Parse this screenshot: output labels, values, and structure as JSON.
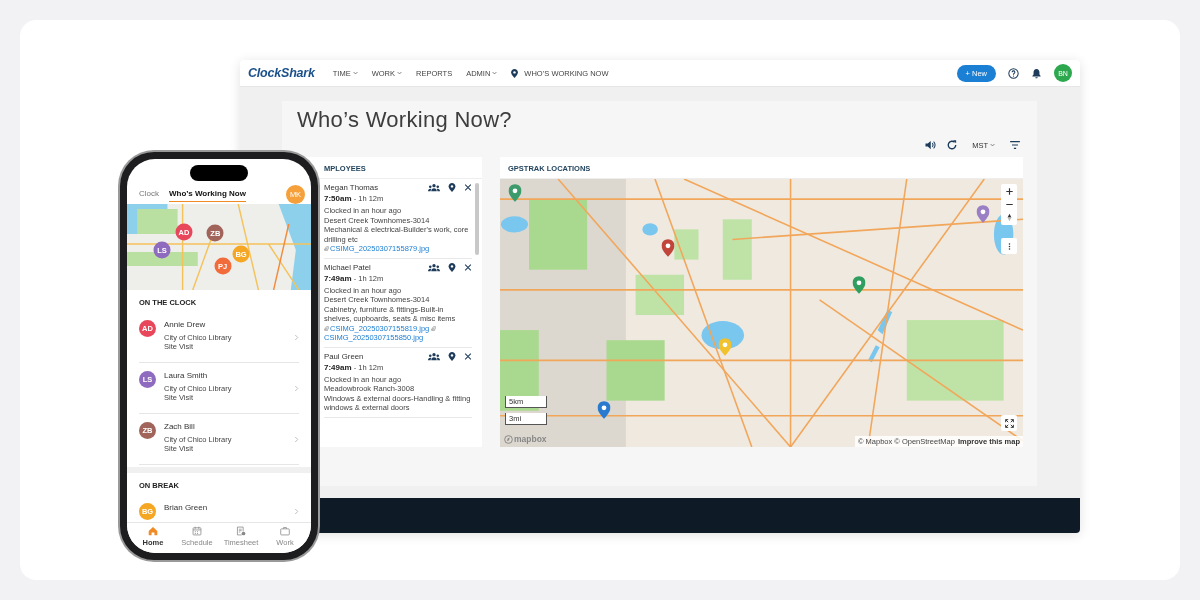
{
  "nav": {
    "logo": "ClockShark",
    "menu": [
      {
        "label": "TIME",
        "kind": "dropdown"
      },
      {
        "label": "WORK",
        "kind": "dropdown"
      },
      {
        "label": "REPORTS",
        "kind": "link"
      },
      {
        "label": "ADMIN",
        "kind": "dropdown"
      },
      {
        "label": "WHO’S WORKING NOW",
        "kind": "location"
      }
    ],
    "new_button": "+ New",
    "user_initials": "BN"
  },
  "page": {
    "title": "Who’s Working Now?",
    "timezone": "MST"
  },
  "employees": {
    "header": "MPLOYEES",
    "items": [
      {
        "name": "Megan Thomas",
        "time": "7:50am",
        "duration": "- 1h 12m",
        "details": [
          "Clocked in an hour ago",
          "Desert Creek Townhomes-3014",
          "Mechanical & electrical-Builder's work, core drilling etc"
        ],
        "attachments": [
          "CSIMG_20250307155879.jpg"
        ]
      },
      {
        "name": "Michael Patel",
        "time": "7:49am",
        "duration": "- 1h 12m",
        "details": [
          "Clocked in an hour ago",
          "Desert Creek Townhomes-3014",
          "Cabinetry, furniture & fittings-Built-in shelves, cupboards, seats & misc items"
        ],
        "attachments": [
          "CSIMG_20250307155819.jpg",
          "CSIMG_20250307155850.jpg"
        ]
      },
      {
        "name": "Paul Green",
        "time": "7:49am",
        "duration": "- 1h 12m",
        "details": [
          "Clocked in an hour ago",
          "Meadowbrook Ranch-3008",
          "Windows & external doors-Handling & fitting windows & external doors"
        ]
      }
    ]
  },
  "map": {
    "header": "GPSTRAK LOCATIONS",
    "pins": [
      {
        "color": "#3d9a6a"
      },
      {
        "color": "#c2453b"
      },
      {
        "color": "#9b7fc4"
      },
      {
        "color": "#2f9e5e"
      },
      {
        "color": "#f2c12e"
      },
      {
        "color": "#2a7bd0"
      }
    ],
    "scale": [
      "5km",
      "3mi"
    ],
    "logo_text": "mapbox",
    "attribution": "© Mapbox © OpenStreetMap",
    "improve_link": "Improve this map"
  },
  "phone": {
    "tabs": [
      {
        "label": "Clock",
        "selected": false
      },
      {
        "label": "Who’s Working Now",
        "selected": true
      }
    ],
    "user_initials": "MK",
    "markers": [
      {
        "initials": "AD",
        "color": "#e8475b"
      },
      {
        "initials": "ZB",
        "color": "#a0645a"
      },
      {
        "initials": "LS",
        "color": "#8e6bbf"
      },
      {
        "initials": "BG",
        "color": "#f5a623"
      },
      {
        "initials": "PJ",
        "color": "#f26b3a"
      }
    ],
    "sections": [
      {
        "title": "ON THE CLOCK",
        "people": [
          {
            "initials": "AD",
            "name": "Annie Drew",
            "color": "#e8475b",
            "location": "City of Chico Library",
            "task": "Site Visit"
          },
          {
            "initials": "LS",
            "name": "Laura Smith",
            "color": "#8e6bbf",
            "location": "City of Chico Library",
            "task": "Site Visit"
          },
          {
            "initials": "ZB",
            "name": "Zach Bill",
            "color": "#a0645a",
            "location": "City of Chico Library",
            "task": "Site Visit"
          }
        ]
      },
      {
        "title": "ON BREAK",
        "people": [
          {
            "initials": "BG",
            "name": "Brian Green",
            "color": "#f5a623"
          }
        ]
      }
    ],
    "bottom_nav": [
      {
        "label": "Home",
        "selected": true
      },
      {
        "label": "Schedule",
        "selected": false
      },
      {
        "label": "Timesheet",
        "selected": false
      },
      {
        "label": "Work",
        "selected": false
      }
    ]
  }
}
